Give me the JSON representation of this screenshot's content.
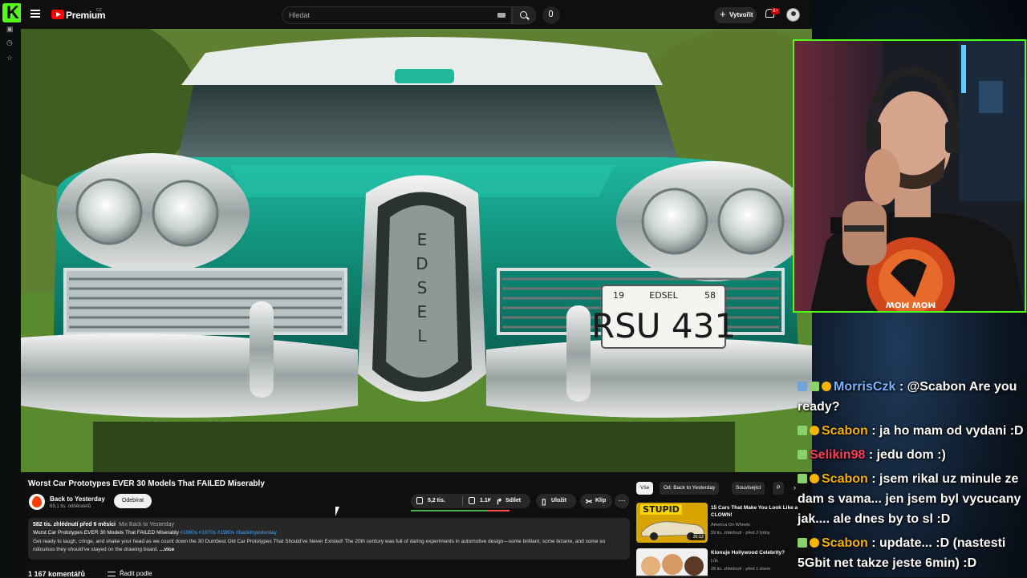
{
  "youtube": {
    "brand": "Premium",
    "region": "CZ",
    "search_placeholder": "Hledat",
    "create_label": "Vytvořit",
    "notifications_badge": "9+"
  },
  "video": {
    "title": "Worst Car Prototypes EVER 30 Models That FAILED Miserably",
    "plate_top_left": "19",
    "plate_top_mid": "EDSEL",
    "plate_top_right": "58",
    "plate_main": "RSU 431",
    "grille_text": "EDSEL"
  },
  "channel": {
    "name": "Back to Yesterday",
    "subscribers": "69,1 tis. odběratelů",
    "subscribe_label": "Odebírat"
  },
  "actions": {
    "likes": "5,2 tis.",
    "dislikes": "1.1K",
    "like_ratio": 0.78,
    "share": "Sdílet",
    "save": "Uložit",
    "clip": "Klip"
  },
  "description": {
    "views_date": "582 tis. zhlédnutí  před 6 měsíci",
    "mix": "Mix Back to Yesterday",
    "title_line": "Worst Car Prototypes EVER 30 Models That FAILED Miserably",
    "hashtags": "#1960s #1970s #1980s #backtoyesterday",
    "body": "Get ready to laugh, cringe, and shake your head as we count down the 30 Dumbest Old Car Prototypes That Should've Never Existed! The 20th century was full of daring experiments in automotive design—some brilliant, some bizarre, and some so ridiculous they should've stayed on the drawing board.",
    "more": "...více"
  },
  "comments": {
    "count": "1 167 komentářů",
    "sort_label": "Řadit podle"
  },
  "sidebar": {
    "chips": [
      "Vše",
      "Od: Back to Yesterday",
      "Související",
      "P"
    ],
    "recommendations": [
      {
        "title": "15 Cars That Make You Look Like a CLOWN!",
        "channel": "America On Wheels",
        "meta": "59 tis. zhlédnutí · před 3 týdny",
        "duration": "26:12",
        "thumb_text": "STUPID"
      },
      {
        "title": "Klonuje Hollywood Celebrity?",
        "channel": "Lůk",
        "meta": "28 tis. zhlédnutí · před 1 dnem",
        "duration": ""
      }
    ]
  },
  "chat": {
    "messages": [
      {
        "user": "MorrisCzk",
        "text": ": @Scabon Are you ready?"
      },
      {
        "user": "Scabon",
        "text": ": ja ho mam od vydani :D"
      },
      {
        "user": "Selikin98",
        "text": ": jedu dom :)"
      },
      {
        "user": "Scabon",
        "text": ": jsem rikal uz minule ze dam s vama... jen jsem byl vycucany jak.... ale dnes by to sl :D"
      },
      {
        "user": "Scabon",
        "text": ": update... :D (nastesti 5Gbit net takze jeste 6min) :D"
      }
    ]
  },
  "webcam": {
    "shirt_text": "MOW MOW"
  },
  "colors": {
    "kick_green": "#53fc18",
    "yt_red": "#ff0000",
    "morris": "#7ab3ff",
    "scabon": "#f5b100",
    "selikin": "#ff3b58"
  }
}
